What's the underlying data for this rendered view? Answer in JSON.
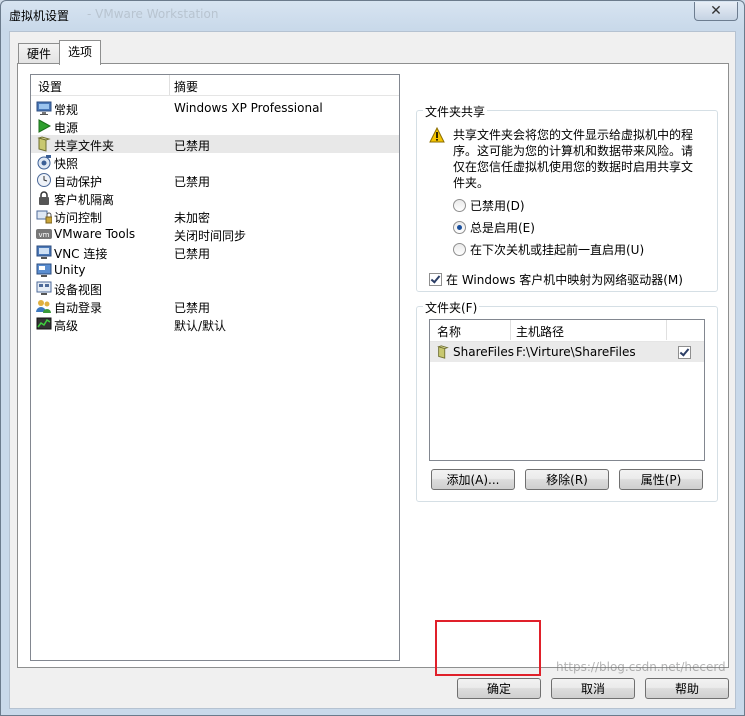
{
  "window": {
    "title": "虚拟机设置",
    "title_ghost": "- VMware Workstation",
    "close_glyph": "✕"
  },
  "tabs": [
    {
      "label": "硬件",
      "active": false
    },
    {
      "label": "选项",
      "active": true
    }
  ],
  "settings_list": {
    "col_setting": "设置",
    "col_summary": "摘要",
    "rows": [
      {
        "name": "常规",
        "summary": "Windows XP Professional",
        "icon": "monitor-icon",
        "selected": false
      },
      {
        "name": "电源",
        "summary": "",
        "icon": "play-icon",
        "selected": false
      },
      {
        "name": "共享文件夹",
        "summary": "已禁用",
        "icon": "shared-folder-icon",
        "selected": true
      },
      {
        "name": "快照",
        "summary": "",
        "icon": "snapshot-icon",
        "selected": false
      },
      {
        "name": "自动保护",
        "summary": "已禁用",
        "icon": "clock-icon",
        "selected": false
      },
      {
        "name": "客户机隔离",
        "summary": "",
        "icon": "lock-icon",
        "selected": false
      },
      {
        "name": "访问控制",
        "summary": "未加密",
        "icon": "access-control-icon",
        "selected": false
      },
      {
        "name": "VMware Tools",
        "summary": "关闭时间同步",
        "icon": "vm-icon",
        "selected": false
      },
      {
        "name": "VNC 连接",
        "summary": "已禁用",
        "icon": "vnc-icon",
        "selected": false
      },
      {
        "name": "Unity",
        "summary": "",
        "icon": "unity-icon",
        "selected": false
      },
      {
        "name": "设备视图",
        "summary": "",
        "icon": "device-view-icon",
        "selected": false
      },
      {
        "name": "自动登录",
        "summary": "已禁用",
        "icon": "users-icon",
        "selected": false
      },
      {
        "name": "高级",
        "summary": "默认/默认",
        "icon": "advanced-icon",
        "selected": false
      }
    ]
  },
  "sharing": {
    "legend": "文件夹共享",
    "warning": "共享文件夹会将您的文件显示给虚拟机中的程序。这可能为您的计算机和数据带来风险。请仅在您信任虚拟机使用您的数据时启用共享文件夹。",
    "options": [
      {
        "label": "已禁用(D)",
        "selected": false
      },
      {
        "label": "总是启用(E)",
        "selected": true
      },
      {
        "label": "在下次关机或挂起前一直启用(U)",
        "selected": false
      }
    ],
    "map_drive_label": "在 Windows 客户机中映射为网络驱动器(M)",
    "map_drive_checked": true
  },
  "folders": {
    "legend": "文件夹(F)",
    "col_name": "名称",
    "col_path": "主机路径",
    "rows": [
      {
        "name": "ShareFiles",
        "path": "F:\\Virture\\ShareFiles",
        "enabled": true
      }
    ],
    "add_label": "添加(A)...",
    "remove_label": "移除(R)",
    "properties_label": "属性(P)"
  },
  "footer": {
    "ok_label": "确定",
    "cancel_label": "取消",
    "help_label": "帮助"
  },
  "watermark": "https://blog.csdn.net/hecerd",
  "colors": {
    "highlight_box": "#e0202a",
    "selected_row": "#e8e8e8"
  }
}
